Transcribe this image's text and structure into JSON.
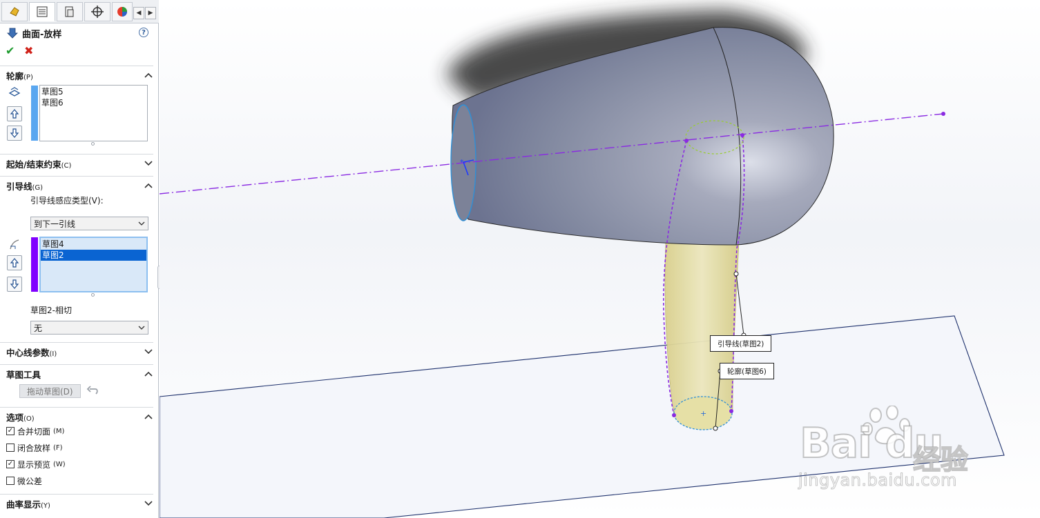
{
  "panel": {
    "tabs": [
      "featuremanager-tab",
      "propertymanager-tab",
      "configurationmanager-tab",
      "dimxpert-tab",
      "display-tab"
    ],
    "title": "曲面-放样",
    "help": "?",
    "ok": "✔",
    "cancel": "✖",
    "profiles": {
      "header": "轮廓",
      "key": "(P)",
      "items": [
        "草图5",
        "草图6"
      ],
      "color": "#5aa7f0"
    },
    "start_end": {
      "header": "起始/结束约束",
      "key": "(C)"
    },
    "guides": {
      "header": "引导线",
      "key": "(G)",
      "influence_label": "引导线感应类型(V):",
      "influence_value": "到下一引线",
      "items": [
        "草图4",
        "草图2"
      ],
      "selected_index": 1,
      "color": "#8000ff",
      "tangent_label": "草图2-相切",
      "tangent_value": "无"
    },
    "centerline": {
      "header": "中心线参数",
      "key": "(I)"
    },
    "sketch_tools": {
      "header": "草图工具",
      "drag_button": "拖动草图(D)"
    },
    "options": {
      "header": "选项",
      "key": "(O)",
      "items": [
        {
          "label": "合并切面",
          "key": "(M)",
          "checked": true
        },
        {
          "label": "闭合放样",
          "key": "(F)",
          "checked": false
        },
        {
          "label": "显示预览",
          "key": "(W)",
          "checked": true
        },
        {
          "label": "微公差",
          "key": "",
          "checked": false
        }
      ]
    },
    "curvature": {
      "header": "曲率显示",
      "key": "(Y)"
    }
  },
  "viewport": {
    "callout_guide": "引导线(草图2)",
    "callout_profile": "轮廓(草图6)",
    "body_color": "#8e93a8",
    "handle_color": "#e6e0a6",
    "axis_color": "#8a2be2"
  },
  "watermark": {
    "logo": "Bai du",
    "brand": "经验",
    "url": "jingyan.baidu.com"
  }
}
